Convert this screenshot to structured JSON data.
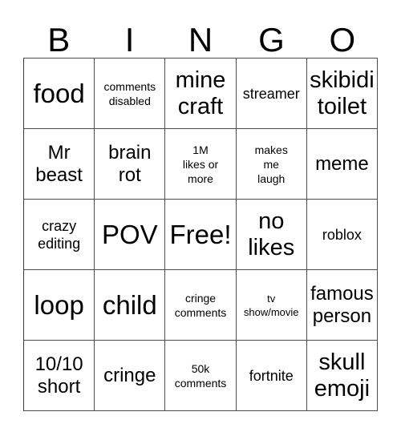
{
  "card": {
    "header_letters": [
      "B",
      "I",
      "N",
      "G",
      "O"
    ],
    "rows": [
      [
        {
          "text": "food",
          "size": "xl"
        },
        {
          "text": "comments\ndisabled",
          "size": "xs"
        },
        {
          "text": "mine\ncraft",
          "size": "lg"
        },
        {
          "text": "streamer",
          "size": "sm"
        },
        {
          "text": "skibidi\ntoilet",
          "size": "lg"
        }
      ],
      [
        {
          "text": "Mr\nbeast",
          "size": "md"
        },
        {
          "text": "brain\nrot",
          "size": "md"
        },
        {
          "text": "1M\nlikes or\nmore",
          "size": "xs"
        },
        {
          "text": "makes\nme\nlaugh",
          "size": "xs"
        },
        {
          "text": "meme",
          "size": "md"
        }
      ],
      [
        {
          "text": "crazy\nediting",
          "size": "sm"
        },
        {
          "text": "POV",
          "size": "xl"
        },
        {
          "text": "Free!",
          "size": "xl"
        },
        {
          "text": "no\nlikes",
          "size": "lg"
        },
        {
          "text": "roblox",
          "size": "sm"
        }
      ],
      [
        {
          "text": "loop",
          "size": "xl"
        },
        {
          "text": "child",
          "size": "xl"
        },
        {
          "text": "cringe\ncomments",
          "size": "xs"
        },
        {
          "text": "tv\nshow/movie",
          "size": "xxs"
        },
        {
          "text": "famous\nperson",
          "size": "md"
        }
      ],
      [
        {
          "text": "10/10\nshort",
          "size": "md"
        },
        {
          "text": "cringe",
          "size": "md"
        },
        {
          "text": "50k\ncomments",
          "size": "xs"
        },
        {
          "text": "fortnite",
          "size": "sm"
        },
        {
          "text": "skull\nemoji",
          "size": "lg"
        }
      ]
    ]
  },
  "colors": {
    "background": "#ffffff",
    "text": "#000000",
    "grid_line": "#4d4d4d"
  }
}
